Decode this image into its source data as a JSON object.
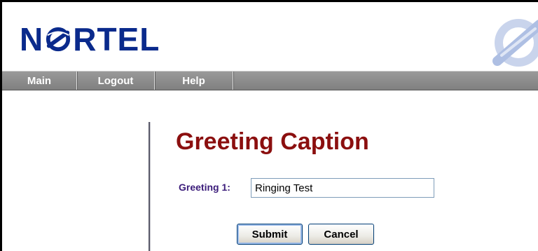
{
  "header": {
    "logo_prefix": "N",
    "logo_suffix": "RTEL"
  },
  "nav": {
    "items": [
      {
        "label": "Main"
      },
      {
        "label": "Logout"
      },
      {
        "label": "Help"
      }
    ]
  },
  "main": {
    "title": "Greeting Caption",
    "field_label": "Greeting 1:",
    "greeting_value": "Ringing Test",
    "submit_label": "Submit",
    "cancel_label": "Cancel"
  },
  "colors": {
    "brand_blue": "#0a2a8c",
    "title_red": "#8b0f0f",
    "label_purple": "#3b1c7a",
    "nav_gray": "#8c8c8c"
  }
}
